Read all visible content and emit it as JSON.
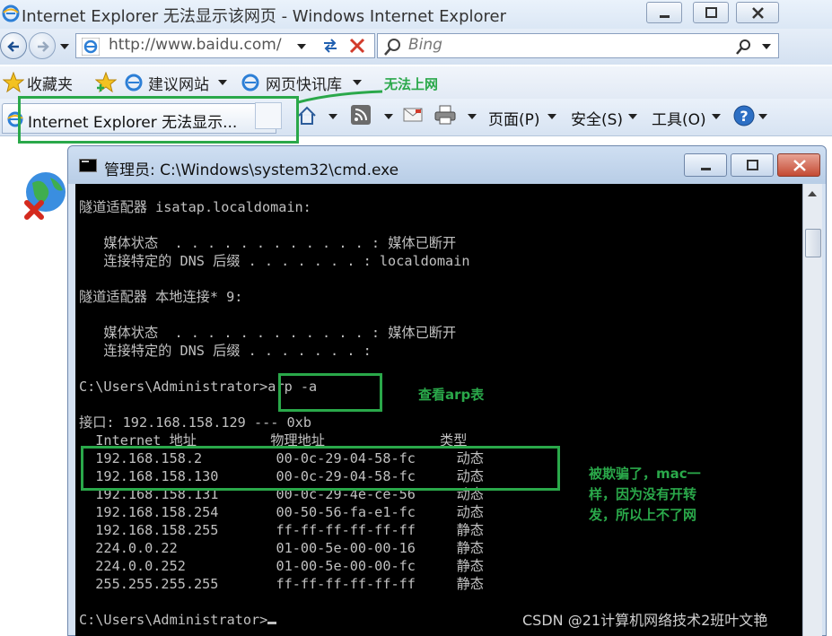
{
  "ie": {
    "title": "Internet Explorer 无法显示该网页 - Windows Internet Explorer",
    "address": "http://www.baidu.com/",
    "search_placeholder": "Bing",
    "favorites_label": "收藏夹",
    "suggested_sites": "建议网站",
    "web_slice_gallery": "网页快讯库",
    "tab_title": "Internet Explorer 无法显示...",
    "menu": {
      "page": "页面(P)",
      "safety": "安全(S)",
      "tools": "工具(O)"
    }
  },
  "cmd": {
    "title": "管理员: C:\\Windows\\system32\\cmd.exe",
    "lines": [
      "隧道适配器 isatap.localdomain:",
      "",
      "   媒体状态  . . . . . . . . . . . . : 媒体已断开",
      "   连接特定的 DNS 后缀 . . . . . . . : localdomain",
      "",
      "隧道适配器 本地连接* 9:",
      "",
      "   媒体状态  . . . . . . . . . . . . : 媒体已断开",
      "   连接特定的 DNS 后缀 . . . . . . . :",
      "",
      "C:\\Users\\Administrator>arp -a",
      "",
      "接口: 192.168.158.129 --- 0xb",
      "  Internet 地址         物理地址              类型",
      "  192.168.158.2         00-0c-29-04-58-fc     动态",
      "  192.168.158.130       00-0c-29-04-58-fc     动态",
      "  192.168.158.131       00-0c-29-4e-ce-56     动态",
      "  192.168.158.254       00-50-56-fa-e1-fc     动态",
      "  192.168.158.255       ff-ff-ff-ff-ff-ff     静态",
      "  224.0.0.22            01-00-5e-00-00-16     静态",
      "  224.0.0.252           01-00-5e-00-00-fc     静态",
      "  255.255.255.255       ff-ff-ff-ff-ff-ff     静态",
      "",
      "C:\\Users\\Administrator>"
    ]
  },
  "annotations": {
    "no_internet": "无法上网",
    "view_arp": "查看arp表",
    "spoofed_line1": "被欺骗了，mac一",
    "spoofed_line2": "样，因为没有开转",
    "spoofed_line3": "发，所以上不了网"
  },
  "colors": {
    "annotation_green": "#2aa84a",
    "console_bg": "#000000",
    "console_fg": "#c0c0c0"
  },
  "watermark": "CSDN @21计算机网络技术2班叶文艳"
}
